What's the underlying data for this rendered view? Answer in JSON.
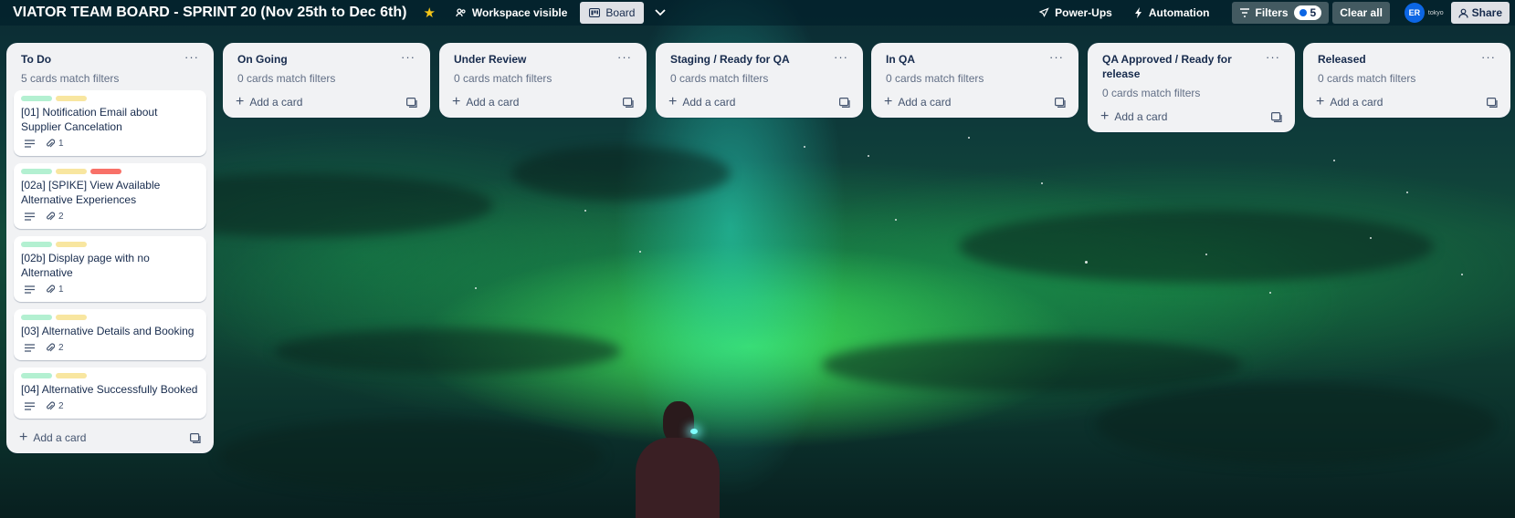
{
  "header": {
    "board_title": "VIATOR TEAM BOARD - SPRINT 20 (Nov 25th to Dec 6th)",
    "visibility_label": "Workspace visible",
    "board_view_label": "Board",
    "powerups_label": "Power-Ups",
    "automation_label": "Automation",
    "filters_label": "Filters",
    "filters_count": "5",
    "clear_all_label": "Clear all",
    "avatar_initials": "ER",
    "avatar_secondary": "tokyo",
    "share_label": "Share",
    "accent_color": "#0c66e4",
    "star_color": "#f5c518"
  },
  "add_card_label": "Add a card",
  "lists": [
    {
      "title": "To Do",
      "match_text": "5 cards match filters",
      "cards": [
        {
          "title": "[01] Notification Email about Supplier Cancelation",
          "labels": [
            "#b3f0d1",
            "#f8e6a0"
          ],
          "attachments": "1"
        },
        {
          "title": "[02a] [SPIKE] View Available Alternative Experiences",
          "labels": [
            "#b3f0d1",
            "#f8e6a0",
            "#f87168"
          ],
          "attachments": "2"
        },
        {
          "title": "[02b] Display page with no Alternative",
          "labels": [
            "#b3f0d1",
            "#f8e6a0"
          ],
          "attachments": "1"
        },
        {
          "title": "[03] Alternative Details and Booking",
          "labels": [
            "#b3f0d1",
            "#f8e6a0"
          ],
          "attachments": "2"
        },
        {
          "title": "[04] Alternative Successfully Booked",
          "labels": [
            "#b3f0d1",
            "#f8e6a0"
          ],
          "attachments": "2"
        }
      ]
    },
    {
      "title": "On Going",
      "match_text": "0 cards match filters",
      "cards": []
    },
    {
      "title": "Under Review",
      "match_text": "0 cards match filters",
      "cards": []
    },
    {
      "title": "Staging / Ready for QA",
      "match_text": "0 cards match filters",
      "cards": []
    },
    {
      "title": "In QA",
      "match_text": "0 cards match filters",
      "cards": []
    },
    {
      "title": "QA Approved / Ready for release",
      "match_text": "0 cards match filters",
      "cards": []
    },
    {
      "title": "Released",
      "match_text": "0 cards match filters",
      "cards": []
    }
  ]
}
